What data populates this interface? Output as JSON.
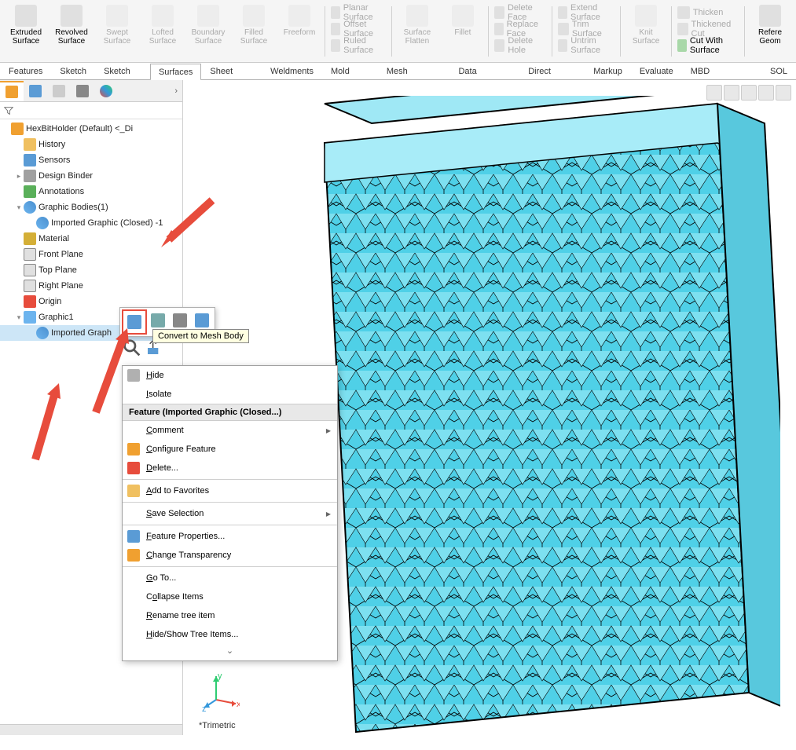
{
  "ribbon": {
    "big": [
      {
        "label": "Extruded Surface",
        "enabled": true
      },
      {
        "label": "Revolved Surface",
        "enabled": true
      },
      {
        "label": "Swept Surface",
        "enabled": false
      },
      {
        "label": "Lofted Surface",
        "enabled": false
      },
      {
        "label": "Boundary Surface",
        "enabled": false
      },
      {
        "label": "Filled Surface",
        "enabled": false
      },
      {
        "label": "Freeform",
        "enabled": false
      }
    ],
    "surf_group": [
      "Planar Surface",
      "Offset Surface",
      "Ruled Surface"
    ],
    "mid_big": [
      {
        "label": "Surface Flatten",
        "enabled": false
      },
      {
        "label": "Fillet",
        "enabled": false
      }
    ],
    "face_group": [
      "Delete Face",
      "Replace Face",
      "Delete Hole"
    ],
    "ext_group": [
      "Extend Surface",
      "Trim Surface",
      "Untrim Surface"
    ],
    "knit": {
      "label": "Knit Surface",
      "enabled": false
    },
    "thick_group": [
      "Thicken",
      "Thickened Cut",
      "Cut With Surface"
    ],
    "ref": "Refere Geom"
  },
  "tabs": [
    "Features",
    "Sketch",
    "Sketch Ink",
    "Surfaces",
    "Sheet Metal",
    "Weldments",
    "Mold Tools",
    "Mesh Modeling",
    "Data Migration",
    "Direct Editing",
    "Markup",
    "Evaluate",
    "MBD Dimensions",
    "SOL"
  ],
  "active_tab": 3,
  "tree": {
    "root": "HexBitHolder (Default) <<Default>_Di",
    "items": [
      {
        "label": "History",
        "cls": "folder"
      },
      {
        "label": "Sensors",
        "cls": "sensor"
      },
      {
        "label": "Design Binder",
        "cls": "binder",
        "exp": "▸"
      },
      {
        "label": "Annotations",
        "cls": "ann"
      },
      {
        "label": "Graphic Bodies(1)",
        "cls": "mesh",
        "exp": "▾",
        "children": [
          {
            "label": "Imported Graphic (Closed) -1",
            "cls": "mesh"
          }
        ]
      },
      {
        "label": "Material <not specified>",
        "cls": "mat"
      },
      {
        "label": "Front Plane",
        "cls": "plane"
      },
      {
        "label": "Top Plane",
        "cls": "plane"
      },
      {
        "label": "Right Plane",
        "cls": "plane"
      },
      {
        "label": "Origin",
        "cls": "origin"
      },
      {
        "label": "Graphic1",
        "cls": "graphic",
        "exp": "▾",
        "children": [
          {
            "label": "Imported Graph",
            "cls": "mesh",
            "sel": true
          }
        ]
      }
    ]
  },
  "tooltip": "Convert to Mesh Body",
  "ctx": {
    "header": "Feature (Imported Graphic (Closed...)",
    "items": [
      {
        "label": "Hide",
        "u": "H",
        "icon": "#b0b0b0"
      },
      {
        "label": "Isolate",
        "u": "I"
      },
      {
        "label": "Comment",
        "u": "C",
        "sub": true
      },
      {
        "label": "Configure Feature",
        "u": "C",
        "icon": "#f0a030"
      },
      {
        "label": "Delete...",
        "u": "D",
        "icon": "#e74c3c"
      },
      {
        "label": "Add to Favorites",
        "u": "A",
        "icon": "#f0c060"
      },
      {
        "label": "Save Selection",
        "u": "S",
        "sub": true
      },
      {
        "label": "Feature Properties...",
        "u": "F",
        "icon": "#5a9bd5"
      },
      {
        "label": "Change Transparency",
        "u": "C",
        "icon": "#f0a030"
      },
      {
        "label": "Go To...",
        "u": "G"
      },
      {
        "label": "Collapse Items",
        "u": "C"
      },
      {
        "label": "Rename tree item",
        "u": "R"
      },
      {
        "label": "Hide/Show Tree Items...",
        "u": "H"
      }
    ]
  },
  "axes": {
    "x": "x",
    "y": "y",
    "z": "z"
  },
  "viewname": "*Trimetric"
}
